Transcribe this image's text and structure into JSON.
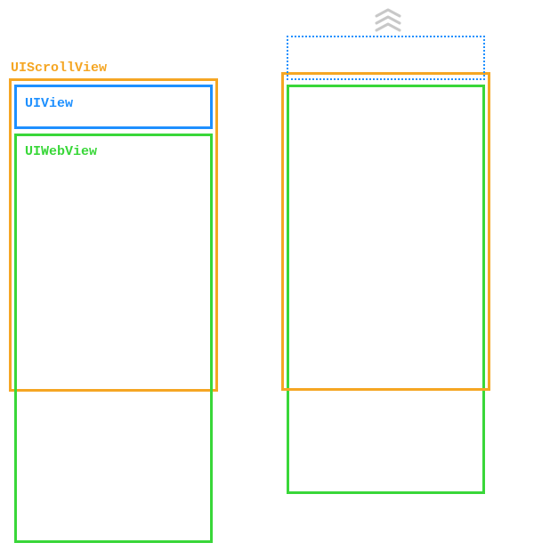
{
  "labels": {
    "scrollview": "UIScrollView",
    "uiview": "UIView",
    "webview": "UIWebView"
  },
  "colors": {
    "scrollview": "#f5a623",
    "uiview": "#1e90ff",
    "webview": "#39d739",
    "chevron": "#c8c8c8"
  },
  "icons": {
    "scroll_up": "chevron-up-stack"
  }
}
